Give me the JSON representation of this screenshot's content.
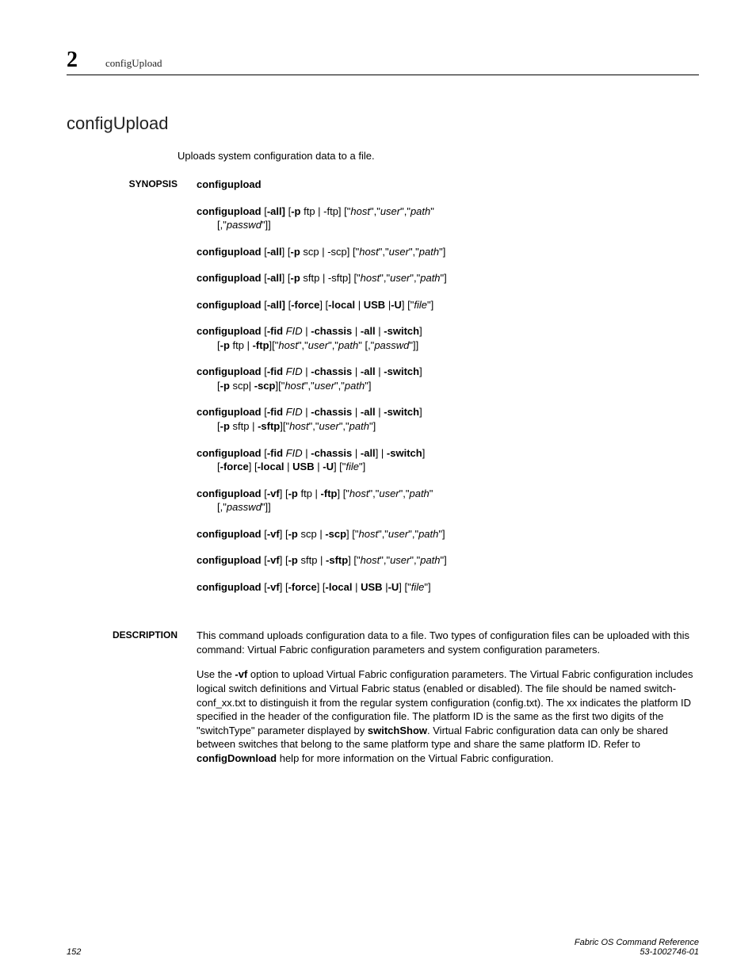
{
  "header": {
    "chapter": "2",
    "cmd": "configUpload"
  },
  "title": "configUpload",
  "summary": "Uploads system configuration data to a file.",
  "sections": {
    "synopsis_label": "SYNOPSIS",
    "description_label": "DESCRIPTION"
  },
  "synopsis": {
    "cmd": "configupload",
    "e1_a": "configupload",
    "e1_b": " [",
    "e1_c": "-all]",
    "e1_d": " [",
    "e1_e": "-p",
    "e1_f": " ftp | -ftp] [\"",
    "e1_g": "host",
    "e1_h": "\",\"",
    "e1_i": "user",
    "e1_j": "\",\"",
    "e1_k": "path",
    "e1_l": "\"",
    "e1_m": "[,\"",
    "e1_n": "passwd",
    "e1_o": "\"]]",
    "e2_a": "configupload",
    "e2_b": " [",
    "e2_c": "-all",
    "e2_d": "] [",
    "e2_e": "-p",
    "e2_f": " scp | -scp] [\"",
    "e2_g": "host",
    "e2_h": "\",\"",
    "e2_i": "user",
    "e2_j": "\",\"",
    "e2_k": "path",
    "e2_l": "\"]",
    "e3_a": "configupload",
    "e3_b": " [",
    "e3_c": "-all",
    "e3_d": "] [",
    "e3_e": "-p",
    "e3_f": " sftp | -sftp] [\"",
    "e3_g": "host",
    "e3_h": "\",\"",
    "e3_i": "user",
    "e3_j": "\",\"",
    "e3_k": "path",
    "e3_l": "\"]",
    "e4_a": "configupload",
    "e4_b": " [",
    "e4_c": "-all]",
    "e4_d": " [",
    "e4_e": "-force",
    "e4_f": "] [",
    "e4_g": "-local",
    "e4_h": " | ",
    "e4_i": "USB",
    "e4_j": " |",
    "e4_k": "-U",
    "e4_l": "] [\"",
    "e4_m": "file",
    "e4_n": "\"]",
    "e5_a": "configupload",
    "e5_b": " [",
    "e5_c": "-fid ",
    "e5_d": "FID",
    "e5_e": " | ",
    "e5_f": "-chassis",
    "e5_g": " | ",
    "e5_h": "-all",
    "e5_i": " |  ",
    "e5_j": "-switch",
    "e5_k": "]",
    "e5_l": "[",
    "e5_m": "-p",
    "e5_n": " ftp | ",
    "e5_o": "-ftp",
    "e5_p": "][\"",
    "e5_q": "host",
    "e5_r": "\",\"",
    "e5_s": "user",
    "e5_t": "\",\"",
    "e5_u": "path",
    "e5_v": "\" [,\"",
    "e5_w": "passwd",
    "e5_x": "\"]]",
    "e6_a": "configupload",
    "e6_b": " [",
    "e6_c": "-fid ",
    "e6_d": "FID",
    "e6_e": " | ",
    "e6_f": "-chassis",
    "e6_g": " | ",
    "e6_h": "-all",
    "e6_i": " | ",
    "e6_j": "-switch",
    "e6_k": "]",
    "e6_l": "[",
    "e6_m": "-p",
    "e6_n": " scp| ",
    "e6_o": "-scp",
    "e6_p": "][\"",
    "e6_q": "host",
    "e6_r": "\",\"",
    "e6_s": "user",
    "e6_t": "\",\"",
    "e6_u": "path",
    "e6_v": "\"]",
    "e7_a": "configupload",
    "e7_b": " [",
    "e7_c": "-fid ",
    "e7_d": "FID",
    "e7_e": " | ",
    "e7_f": "-chassis",
    "e7_g": " | ",
    "e7_h": "-all",
    "e7_i": " | ",
    "e7_j": "-switch",
    "e7_k": "]",
    "e7_l": "[",
    "e7_m": "-p",
    "e7_n": " sftp | ",
    "e7_o": "-sftp",
    "e7_p": "][\"",
    "e7_q": "host",
    "e7_r": "\",\"",
    "e7_s": "user",
    "e7_t": "\",\"",
    "e7_u": "path",
    "e7_v": "\"]",
    "e8_a": "configupload",
    "e8_b": " [",
    "e8_c": "-fid ",
    "e8_d": "FID",
    "e8_e": " | ",
    "e8_f": "-chassis",
    "e8_g": " | ",
    "e8_h": "-all",
    "e8_i": "] | ",
    "e8_j": "-switch",
    "e8_k": "]",
    "e8_l": "[",
    "e8_m": "-force",
    "e8_n": "] [",
    "e8_o": "-local",
    "e8_p": " | ",
    "e8_q": "USB",
    "e8_r": " | ",
    "e8_s": "-U",
    "e8_t": "] [\"",
    "e8_u": "file",
    "e8_v": "\"]",
    "e9_a": "configupload",
    "e9_b": " [",
    "e9_c": "-vf",
    "e9_d": "] [",
    "e9_e": "-p",
    "e9_f": " ftp | ",
    "e9_g": "-ftp",
    "e9_h": "] [\"",
    "e9_i": "host",
    "e9_j": "\",\"",
    "e9_k": "user",
    "e9_l": "\",\"",
    "e9_m": "path",
    "e9_n": "\"",
    "e9_o": "[,\"",
    "e9_p": "passwd",
    "e9_q": "\"]]",
    "e10_a": "configupload",
    "e10_b": " [",
    "e10_c": "-vf",
    "e10_d": "] [",
    "e10_e": "-p",
    "e10_f": " scp | ",
    "e10_g": "-scp",
    "e10_h": "] [\"",
    "e10_i": "host",
    "e10_j": "\",\"",
    "e10_k": "user",
    "e10_l": "\",\"",
    "e10_m": "path",
    "e10_n": "\"]",
    "e11_a": "configupload",
    "e11_b": " [",
    "e11_c": "-vf",
    "e11_d": "] [",
    "e11_e": "-p",
    "e11_f": " sftp | ",
    "e11_g": "-sftp",
    "e11_h": "] [\"",
    "e11_i": "host",
    "e11_j": "\",\"",
    "e11_k": "user",
    "e11_l": "\",\"",
    "e11_m": "path",
    "e11_n": "\"]",
    "e12_a": "configupload",
    "e12_b": " [",
    "e12_c": "-vf",
    "e12_d": "] [",
    "e12_e": "-force",
    "e12_f": "] [",
    "e12_g": "-local",
    "e12_h": " | ",
    "e12_i": "USB",
    "e12_j": " |",
    "e12_k": "-U",
    "e12_l": "] [\"",
    "e12_m": "file",
    "e12_n": "\"]"
  },
  "description": {
    "p1": "This command uploads configuration data to a file. Two types of configuration files can be uploaded with this command: Virtual Fabric configuration parameters and system configuration parameters.",
    "p2_a": "Use the ",
    "p2_b": "-vf",
    "p2_c": " option to upload Virtual Fabric configuration parameters. The Virtual Fabric configuration includes logical switch definitions and Virtual Fabric status (enabled or disabled). The file should be named switch-conf_xx.txt to distinguish it from the regular system configuration (config.txt). The xx indicates the platform ID specified in the header of the configuration file. The platform ID is the same as the first two digits of the \"switchType\" parameter displayed by ",
    "p2_d": "switchShow",
    "p2_e": ". Virtual Fabric configuration data can only be shared between switches that belong to the same platform type and share the same platform ID. Refer to ",
    "p2_f": "configDownload",
    "p2_g": " help for more information on the Virtual Fabric configuration."
  },
  "footer": {
    "page": "152",
    "doc_title": "Fabric OS Command Reference",
    "doc_id": "53-1002746-01"
  }
}
